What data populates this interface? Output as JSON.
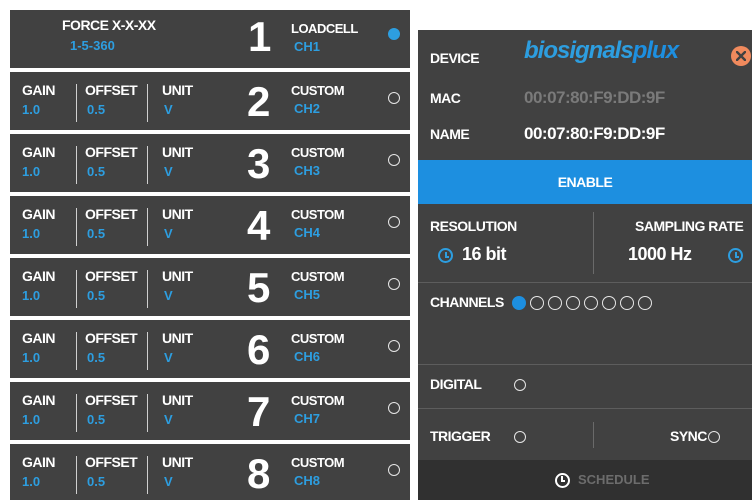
{
  "channel_panel": {
    "sensor_name": "FORCE X-X-XX",
    "sensor_code": "1-5-360",
    "param_labels": {
      "gain": "GAIN",
      "offset": "OFFSET",
      "unit": "UNIT"
    },
    "channels": [
      {
        "number": "1",
        "type": "LOADCELL",
        "name": "CH1",
        "enabled": true
      },
      {
        "number": "2",
        "type": "CUSTOM",
        "name": "CH2",
        "gain": "1.0",
        "offset": "0.5",
        "unit": "V",
        "enabled": false
      },
      {
        "number": "3",
        "type": "CUSTOM",
        "name": "CH3",
        "gain": "1.0",
        "offset": "0.5",
        "unit": "V",
        "enabled": false
      },
      {
        "number": "4",
        "type": "CUSTOM",
        "name": "CH4",
        "gain": "1.0",
        "offset": "0.5",
        "unit": "V",
        "enabled": false
      },
      {
        "number": "5",
        "type": "CUSTOM",
        "name": "CH5",
        "gain": "1.0",
        "offset": "0.5",
        "unit": "V",
        "enabled": false
      },
      {
        "number": "6",
        "type": "CUSTOM",
        "name": "CH6",
        "gain": "1.0",
        "offset": "0.5",
        "unit": "V",
        "enabled": false
      },
      {
        "number": "7",
        "type": "CUSTOM",
        "name": "CH7",
        "gain": "1.0",
        "offset": "0.5",
        "unit": "V",
        "enabled": false
      },
      {
        "number": "8",
        "type": "CUSTOM",
        "name": "CH8",
        "gain": "1.0",
        "offset": "0.5",
        "unit": "V",
        "enabled": false
      }
    ]
  },
  "device_panel": {
    "device_label": "DEVICE",
    "logo": {
      "part1": "bio",
      "part2": "signals",
      "part3": "plux"
    },
    "mac_label": "MAC",
    "mac_value": "00:07:80:F9:DD:9F",
    "name_label": "NAME",
    "name_value": "00:07:80:F9:DD:9F",
    "enable_label": "ENABLE",
    "resolution_label": "RESOLUTION",
    "resolution_value": "16 bit",
    "sampling_label": "SAMPLING RATE",
    "sampling_value": "1000 Hz",
    "channels_label": "CHANNELS",
    "channel_states": [
      true,
      false,
      false,
      false,
      false,
      false,
      false,
      false
    ],
    "digital_label": "DIGITAL",
    "trigger_label": "TRIGGER",
    "sync_label": "SYNC",
    "schedule_label": "SCHEDULE",
    "icons": {
      "close": "close-icon",
      "clock": "clock-icon"
    }
  },
  "colors": {
    "panel_bg": "#414141",
    "accent_blue": "#2d9ee0",
    "enable_blue": "#1d8fe0",
    "close_orange": "#f08a5d",
    "muted_text": "#7a7a7a"
  }
}
